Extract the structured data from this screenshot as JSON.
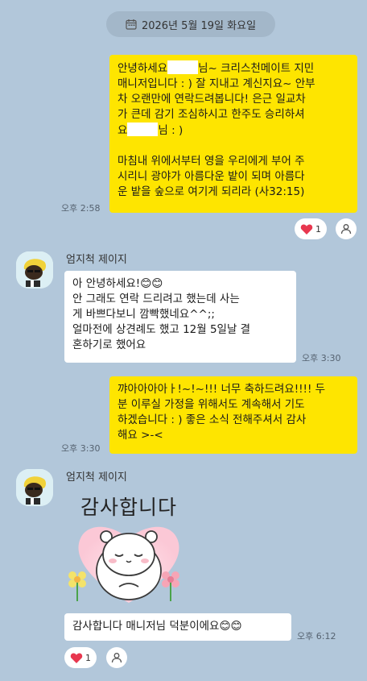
{
  "date_divider": {
    "text": "2026년 5월 19일 화요일",
    "icon": "calendar-icon"
  },
  "messages": [
    {
      "sender": "me",
      "parts": [
        "안녕하세요",
        "님~ 크리스천메이트 지민\n매니저입니다 : ) 잘 지내고 계신지요~ 안부\n차 오랜만에 연락드려봅니다! 은근 일교차\n가 큰데 감기 조심하시고 한주도 승리하셔\n요",
        "님 : )\n\n마침내 위에서부터 영을 우리에게 부어 주\n시리니 광야가 아름다운 밭이 되며 아름다\n운 밭을 숲으로 여기게 되리라 (사32:15)"
      ],
      "time": "오후 2:58",
      "reaction": {
        "icon": "heart-icon",
        "count": "1"
      }
    },
    {
      "sender": "other",
      "name": "엄지척 제이지",
      "text": "아 안녕하세요!😊😊\n안 그래도 연락 드리려고 했는데 사는\n게 바쁘다보니 깜빡했네요^^;;\n얼마전에 상견례도 했고 12월 5일날 결\n혼하기로 했어요",
      "time": "오후 3:30"
    },
    {
      "sender": "me",
      "text": "꺄아아아아ㅏ!~!~!!! 너무 축하드려요!!!! 두\n분 이루실 가정을 위해서도 계속해서 기도\n하겠습니다 : ) 좋은 소식 전해주셔서 감사\n해요 >-<",
      "time": "오후 3:30"
    },
    {
      "sender": "other",
      "name": "엄지척 제이지",
      "sticker_text": "감사합니다",
      "text": "감사합니다 매니저님 덕분이에요😊😊",
      "time": "오후 6:12",
      "reaction": {
        "icon": "heart-icon",
        "count": "1"
      }
    }
  ],
  "colors": {
    "background": "#b2c7da",
    "my_bubble": "#fee500",
    "other_bubble": "#ffffff",
    "heart": "#e8374f"
  }
}
